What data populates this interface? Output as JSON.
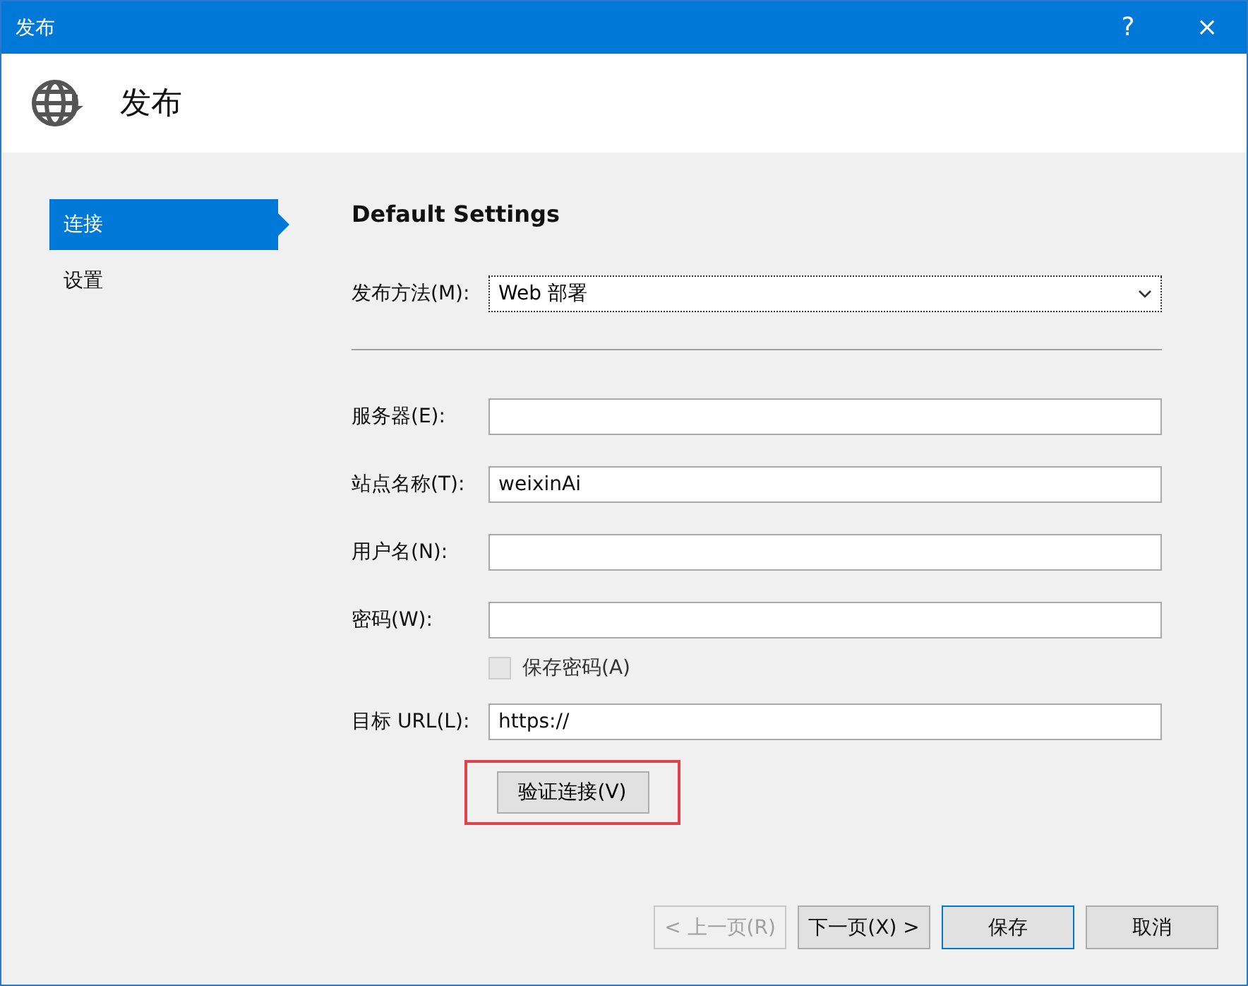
{
  "window": {
    "title": "发布",
    "help": "?",
    "close": "×"
  },
  "header": {
    "title": "发布"
  },
  "sidebar": {
    "items": [
      {
        "label": "连接",
        "selected": true
      },
      {
        "label": "设置",
        "selected": false
      }
    ]
  },
  "section": {
    "title": "Default Settings"
  },
  "method": {
    "label": "发布方法(M):",
    "value": "Web 部署"
  },
  "fields": [
    {
      "kind": "text",
      "label": "服务器(E):"
    },
    {
      "kind": "text",
      "label": "站点名称(T):",
      "value": "weixinAi"
    },
    {
      "kind": "text",
      "label": "用户名(N):"
    },
    {
      "kind": "text",
      "label": "密码(W):"
    },
    {
      "kind": "checkbox",
      "label": "保存密码(A)",
      "checked": false,
      "disabled": true
    },
    {
      "kind": "text",
      "label": "目标 URL(L):",
      "value": "https://"
    }
  ],
  "validate": {
    "label": "验证连接(V)",
    "highlighted": true
  },
  "buttons": [
    {
      "label": "< 上一页(R)",
      "disabled": true,
      "default": false
    },
    {
      "label": "下一页(X) >",
      "disabled": false,
      "default": false
    },
    {
      "label": "保存",
      "disabled": false,
      "default": true
    },
    {
      "label": "取消",
      "disabled": false,
      "default": false
    }
  ]
}
